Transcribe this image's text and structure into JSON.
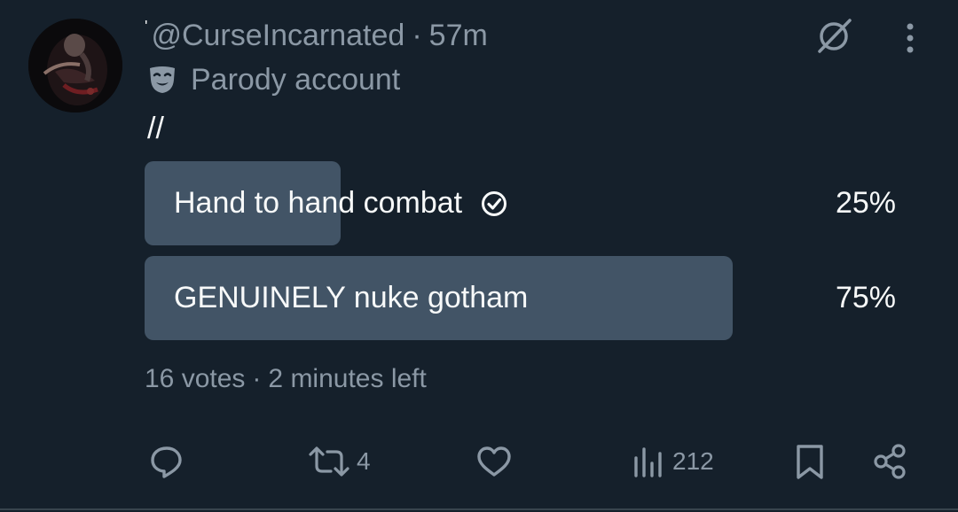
{
  "post": {
    "handle": "@CurseIncarnated",
    "name_fragment": "'",
    "separator": "·",
    "time": "57m",
    "account_label": "Parody account",
    "text": "//"
  },
  "poll": {
    "options": [
      {
        "label": "Hand to hand combat",
        "percent_label": "25%",
        "percent": 25,
        "selected": true
      },
      {
        "label": "GENUINELY nuke gotham",
        "percent_label": "75%",
        "percent": 75,
        "selected": false
      }
    ],
    "votes": "16 votes",
    "separator": "·",
    "time_left": "2 minutes left"
  },
  "actions": {
    "reply_icon": "speech-bubble-icon",
    "repost_icon": "repost-arrows-icon",
    "repost_count": "4",
    "like_icon": "heart-icon",
    "views_icon": "bar-chart-icon",
    "views_count": "212",
    "bookmark_icon": "bookmark-icon",
    "share_icon": "share-nodes-icon"
  },
  "colors": {
    "background": "#15202b",
    "poll_fill": "#425466",
    "muted_text": "#8b98a5",
    "primary_text": "#f7f9f9"
  }
}
